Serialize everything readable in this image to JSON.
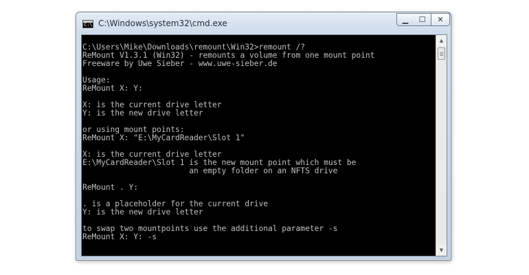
{
  "window": {
    "title": "C:\\Windows\\system32\\cmd.exe",
    "icon_glyph": "C:\\",
    "controls": {
      "minimize": "▁",
      "maximize": "☐",
      "close": "✕"
    }
  },
  "console": {
    "lines": [
      "",
      "C:\\Users\\Mike\\Downloads\\remount\\Win32>remount /?",
      "ReMount V1.3.1 (Win32) - remounts a volume from one mount point",
      "Freeware by Uwe Sieber - www.uwe-sieber.de",
      "",
      "Usage:",
      "ReMount X: Y:",
      "",
      "X: is the current drive letter",
      "Y: is the new drive letter",
      "",
      "or using mount points:",
      "ReMount X: \"E:\\MyCardReader\\Slot 1\"",
      "",
      "X: is the current drive letter",
      "E:\\MyCardReader\\Slot 1 is the new mount point which must be",
      "                       an empty folder on an NFTS drive",
      "",
      "ReMount . Y:",
      "",
      ". is a placeholder for the current drive",
      "Y: is the new drive letter",
      "",
      "to swap two mountpoints use the additional parameter -s",
      "ReMount X: Y: -s",
      ""
    ]
  },
  "scrollbar": {
    "up_arrow": "▲",
    "down_arrow": "▼"
  },
  "colors": {
    "console_background": "#000000",
    "console_text": "#c0c0c0"
  }
}
